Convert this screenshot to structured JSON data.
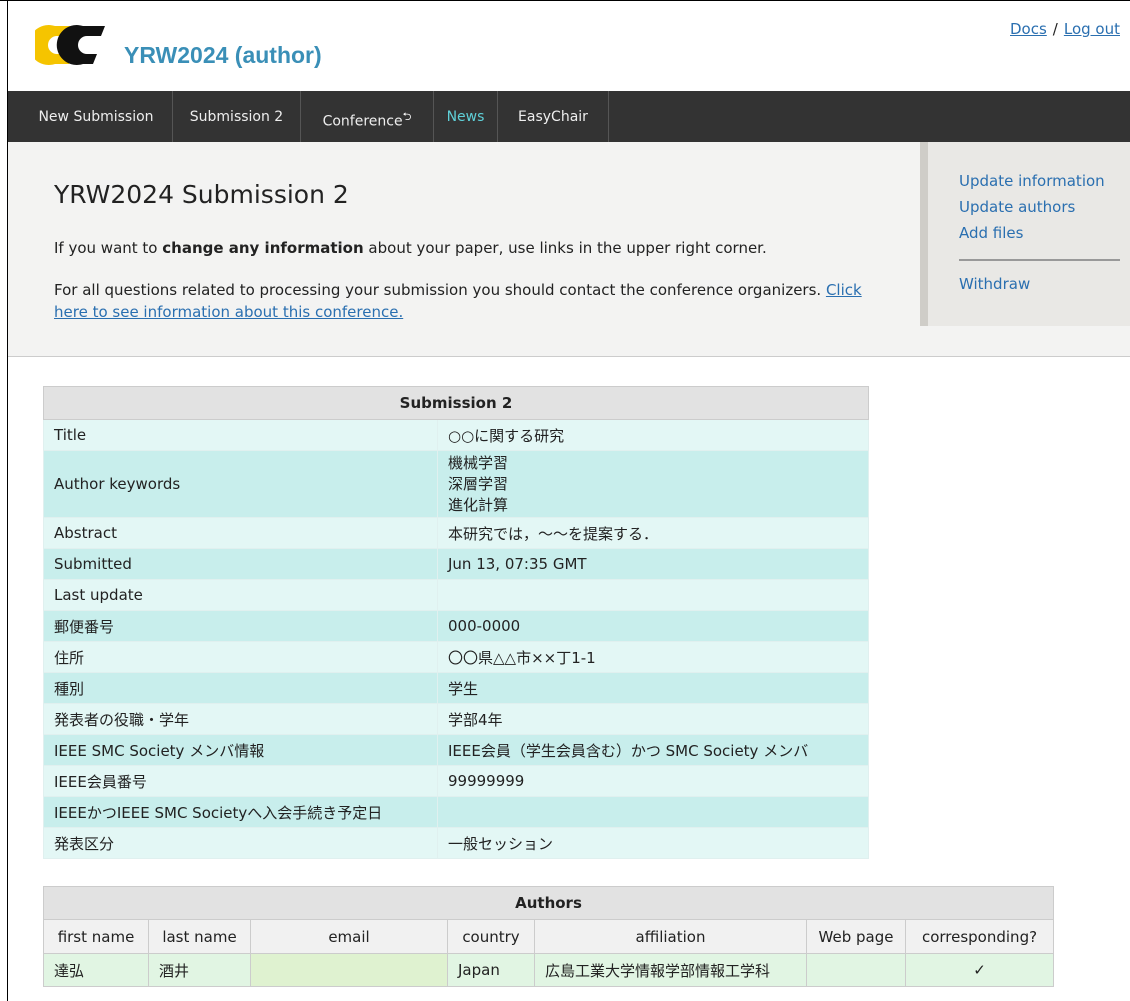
{
  "header": {
    "title": "YRW2024 (author)",
    "links": {
      "docs": "Docs",
      "separator": "/",
      "logout": "Log out"
    }
  },
  "nav": [
    {
      "label": "New Submission"
    },
    {
      "label": "Submission 2"
    },
    {
      "label": "Conference",
      "badge": "⮌"
    },
    {
      "label": "News"
    },
    {
      "label": "EasyChair"
    }
  ],
  "main": {
    "title": "YRW2024 Submission 2",
    "p1_before": "If you want to ",
    "p1_bold": "change any information",
    "p1_after": " about your paper, use links in the upper right corner.",
    "p2_text": "For all questions related to processing your submission you should contact the conference organizers. ",
    "p2_link": "Click here to see information about this conference."
  },
  "side": {
    "update_information": "Update information",
    "update_authors": "Update authors",
    "add_files": "Add files",
    "withdraw": "Withdraw"
  },
  "submission_table": {
    "caption": "Submission 2",
    "rows": {
      "title": {
        "key": "Title",
        "value": "○○に関する研究"
      },
      "keywords": {
        "key": "Author keywords",
        "values": [
          "機械学習",
          "深層学習",
          "進化計算"
        ]
      },
      "abstract": {
        "key": "Abstract",
        "value": "本研究では，～～を提案する．"
      },
      "submitted": {
        "key": "Submitted",
        "value": "Jun 13, 07:35 GMT"
      },
      "last_update": {
        "key": "Last update",
        "value": ""
      },
      "postal": {
        "key": "郵便番号",
        "value": "000-0000"
      },
      "address": {
        "key": "住所",
        "value": "〇〇県△△市××丁1-1"
      },
      "category": {
        "key": "種別",
        "value": "学生"
      },
      "position": {
        "key": "発表者の役職・学年",
        "value": "学部4年"
      },
      "ieee_smc": {
        "key": "IEEE SMC Society メンバ情報",
        "value": "IEEE会員（学生会員含む）かつ SMC Society メンバ"
      },
      "ieee_number": {
        "key": "IEEE会員番号",
        "value": "99999999"
      },
      "join_date": {
        "key": "IEEEかつIEEE SMC Societyへ入会手続き予定日",
        "value": ""
      },
      "session": {
        "key": "発表区分",
        "value": "一般セッション"
      }
    }
  },
  "authors_table": {
    "caption": "Authors",
    "headers": [
      "first name",
      "last name",
      "email",
      "country",
      "affiliation",
      "Web page",
      "corresponding?"
    ],
    "row": {
      "first_name": "達弘",
      "last_name": "酒井",
      "email": "",
      "country": "Japan",
      "affiliation": "広島工業大学情報学部情報工学科",
      "web_page": "",
      "corresponding": "✓"
    }
  },
  "colors": {
    "accent": "#3a8fb7",
    "link": "#2a6fb0",
    "navbar": "#333333",
    "news": "#5fd0d8",
    "logo_yellow": "#f5c400"
  }
}
